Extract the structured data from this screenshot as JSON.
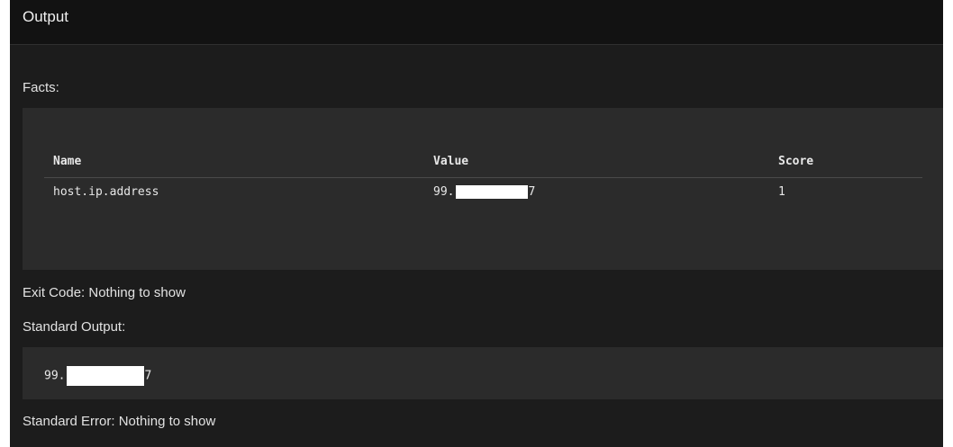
{
  "header": {
    "title": "Output"
  },
  "facts": {
    "label": "Facts:",
    "columns": [
      "Name",
      "Value",
      "Score"
    ],
    "rows": [
      {
        "name": "host.ip.address",
        "value_prefix": "99.",
        "value_suffix": "7",
        "score": "1"
      }
    ]
  },
  "exit_code": {
    "text": "Exit Code: Nothing to show"
  },
  "standard_output": {
    "label": "Standard Output:",
    "value_prefix": "99.",
    "value_suffix": "7"
  },
  "standard_error": {
    "text": "Standard Error: Nothing to show"
  },
  "colors": {
    "panel_background": "#1c1c1c",
    "header_background": "#121212",
    "box_background": "#2b2b2b",
    "text": "#e6e6e6",
    "redaction": "#ffffff"
  }
}
